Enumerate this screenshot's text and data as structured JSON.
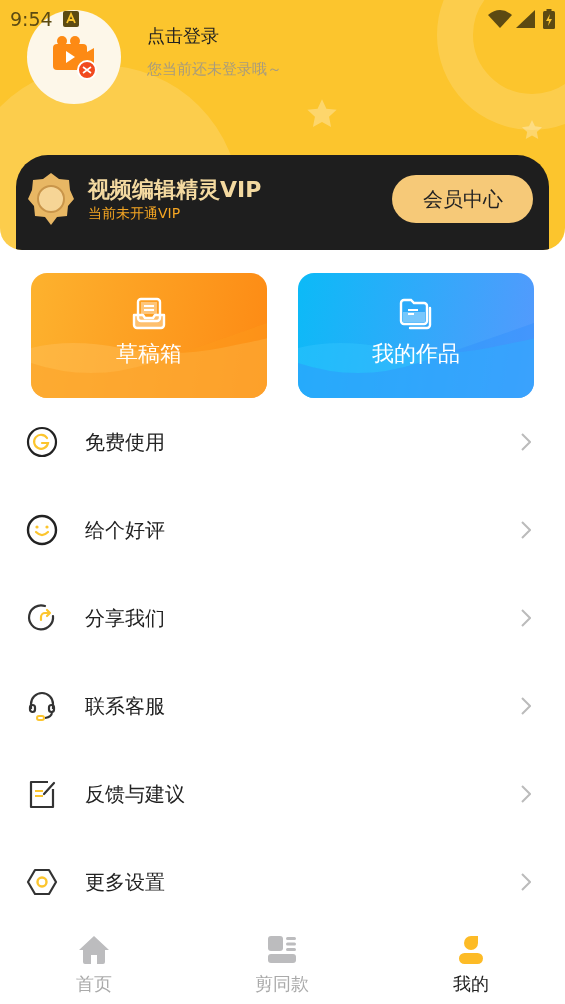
{
  "status_bar": {
    "time": "9:54"
  },
  "profile": {
    "title": "点击登录",
    "subtitle": "您当前还未登录哦～"
  },
  "vip": {
    "title": "视频编辑精灵VIP",
    "status": "当前未开通VIP",
    "button": "会员中心"
  },
  "shortcuts": [
    {
      "label": "草稿箱",
      "kind": "drafts"
    },
    {
      "label": "我的作品",
      "kind": "works"
    }
  ],
  "menu": [
    {
      "label": "免费使用",
      "kind": "free"
    },
    {
      "label": "给个好评",
      "kind": "rate"
    },
    {
      "label": "分享我们",
      "kind": "share"
    },
    {
      "label": "联系客服",
      "kind": "support"
    },
    {
      "label": "反馈与建议",
      "kind": "feedback"
    },
    {
      "label": "更多设置",
      "kind": "settings"
    }
  ],
  "tabs": [
    {
      "label": "首页",
      "kind": "home",
      "selected": false
    },
    {
      "label": "剪同款",
      "kind": "template",
      "selected": false
    },
    {
      "label": "我的",
      "kind": "me",
      "selected": true
    }
  ]
}
